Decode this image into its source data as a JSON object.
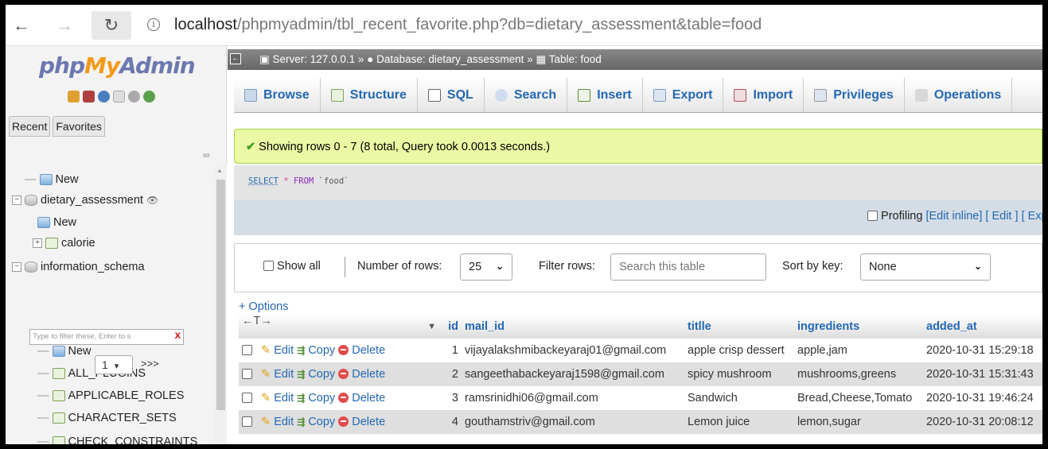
{
  "browser": {
    "url_prefix": "",
    "url_host": "localhost",
    "url_path": "/phpmyadmin/tbl_recent_favorite.php?db=dietary_assessment&table=food",
    "back_glyph": "←",
    "forward_glyph": "→",
    "reload_glyph": "↻",
    "info_glyph": "i"
  },
  "sidebar": {
    "logo_php": "php",
    "logo_my": "My",
    "logo_admin": "Admin",
    "tab_recent": "Recent",
    "tab_favorites": "Favorites",
    "tree": [
      {
        "label": "New",
        "icon": "new-icon"
      },
      {
        "label": "dietary_assessment",
        "icon": "database-icon"
      },
      {
        "label": "New",
        "icon": "new-icon"
      },
      {
        "label": "calorie",
        "icon": "table-icon"
      },
      {
        "label": "information_schema",
        "icon": "database-icon"
      },
      {
        "label": "New",
        "icon": "new-icon"
      },
      {
        "label": "ALL_PLUGINS",
        "icon": "view-icon"
      },
      {
        "label": "APPLICABLE_ROLES",
        "icon": "view-icon"
      },
      {
        "label": "CHARACTER_SETS",
        "icon": "view-icon"
      },
      {
        "label": "CHECK_CONSTRAINTS",
        "icon": "view-icon"
      }
    ],
    "filter_placeholder": "Type to filter these, Enter to s",
    "filter_clear": "X",
    "page_value": "1",
    "page_next": ">>>"
  },
  "breadcrumb": {
    "server": "Server: 127.0.0.1",
    "database": "Database: dietary_assessment",
    "table": "Table: food",
    "sep": "»"
  },
  "tabs": [
    "Browse",
    "Structure",
    "SQL",
    "Search",
    "Insert",
    "Export",
    "Import",
    "Privileges",
    "Operations"
  ],
  "colors": {
    "accent": "#2468b2",
    "success_bg": "#ebf8a4",
    "crumb_bg": "#777777"
  },
  "result": {
    "message": "Showing rows 0 - 7 (8 total, Query took 0.0013 seconds.)",
    "sql_select": "SELECT",
    "sql_star": "*",
    "sql_from": "FROM",
    "sql_table": "`food`",
    "profiling": "Profiling",
    "edit_inline": "[Edit inline]",
    "edit": "[ Edit ]",
    "explain": "[ Explai"
  },
  "navigation": {
    "show_all": "Show all",
    "number_of_rows_label": "Number of rows:",
    "rows_value": "25",
    "filter_label": "Filter rows:",
    "filter_placeholder": "Search this table",
    "sort_label": "Sort by key:",
    "sort_value": "None"
  },
  "options_link": "+ Options",
  "table": {
    "nav_arrows": "←T→",
    "sort_glyph": "▼",
    "columns": [
      "id",
      "mail_id",
      "titlle",
      "ingredients",
      "added_at"
    ],
    "actions": {
      "edit": "Edit",
      "copy": "Copy",
      "delete": "Delete"
    },
    "rows": [
      [
        "1",
        "vijayalakshmibackeyaraj01@gmail.com",
        "apple crisp dessert",
        "apple,jam",
        "2020-10-31 15:29:18"
      ],
      [
        "2",
        "sangeethabackeyaraj1598@gmail.com",
        "spicy mushroom",
        "mushrooms,greens",
        "2020-10-31 15:31:43"
      ],
      [
        "3",
        "ramsrinidhi06@gmail.com",
        "Sandwich",
        "Bread,Cheese,Tomato",
        "2020-10-31 19:46:24"
      ],
      [
        "4",
        "gouthamstriv@gmail.com",
        "Lemon juice",
        "lemon,sugar",
        "2020-10-31 20:08:12"
      ]
    ]
  }
}
